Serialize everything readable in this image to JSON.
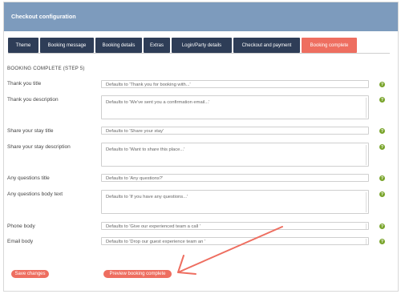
{
  "header": {
    "title": "Checkout configuration"
  },
  "tabs": [
    {
      "label": "Theme",
      "active": false
    },
    {
      "label": "Booking message",
      "active": false
    },
    {
      "label": "Booking details",
      "active": false
    },
    {
      "label": "Extras",
      "active": false
    },
    {
      "label": "Login/Party details",
      "active": false
    },
    {
      "label": "Checkout and payment",
      "active": false
    },
    {
      "label": "Booking complete",
      "active": true
    }
  ],
  "section": {
    "title": "BOOKING COMPLETE (STEP 5)"
  },
  "fields": [
    {
      "label": "Thank you title",
      "placeholder": "Defaults to 'Thank you for booking with...'"
    },
    {
      "label": "Thank you description",
      "placeholder": "Defaults to 'We've sent you a confirmation email...'"
    },
    {
      "label": "Share your stay title",
      "placeholder": "Defaults to 'Share your stay'"
    },
    {
      "label": "Share your stay description",
      "placeholder": "Defaults to 'Want to share this place...'"
    },
    {
      "label": "Any questions title",
      "placeholder": "Defaults to 'Any questions?'"
    },
    {
      "label": "Any questions body text",
      "placeholder": "Defaults to 'If you have any questions...'"
    },
    {
      "label": "Phone body",
      "placeholder": "Defaults to 'Give our experienced team a call '"
    },
    {
      "label": "Email body",
      "placeholder": "Defaults to 'Drop our guest experience team an '"
    }
  ],
  "help_glyph": "?",
  "colors": {
    "header": "#7d9bbd",
    "tab": "#2e3d57",
    "accent": "#ee6e60",
    "help": "#7aa52d"
  },
  "buttons": {
    "save": "Save changes",
    "preview": "Preview booking complete"
  }
}
